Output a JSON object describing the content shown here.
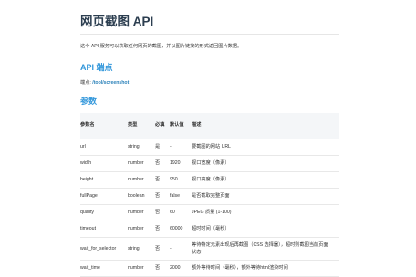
{
  "title": "网页截图 API",
  "intro": "这个 API 服务可以获取任何网页的截图，并以图片链接的形式返回图片数据。",
  "endpoint_section": {
    "heading": "API 端点",
    "label": "端点: ",
    "path": "/tool/screenshot"
  },
  "params_section": {
    "heading": "参数",
    "columns": [
      "参数名",
      "类型",
      "必填",
      "默认值",
      "描述"
    ],
    "rows": [
      {
        "name": "url",
        "type": "string",
        "required": "是",
        "default": "-",
        "desc": "要截图的网站 URL"
      },
      {
        "name": "width",
        "type": "number",
        "required": "否",
        "default": "1920",
        "desc": "视口宽度（像素）"
      },
      {
        "name": "height",
        "type": "number",
        "required": "否",
        "default": "950",
        "desc": "视口高度（像素）"
      },
      {
        "name": "fullPage",
        "type": "boolean",
        "required": "否",
        "default": "false",
        "desc": "是否截取完整页面"
      },
      {
        "name": "quality",
        "type": "number",
        "required": "否",
        "default": "60",
        "desc": "JPEG 质量 (1-100)"
      },
      {
        "name": "timeout",
        "type": "number",
        "required": "否",
        "default": "60000",
        "desc": "超时时间（毫秒）"
      },
      {
        "name": "wait_for_selector",
        "type": "string",
        "required": "否",
        "default": "-",
        "desc": "等待特定元素出现后再截图（CSS 选择器），超时则截图当前页面状态"
      },
      {
        "name": "wait_time",
        "type": "number",
        "required": "否",
        "default": "2000",
        "desc": "额外等待时间（毫秒），额外等待html渲染时间"
      }
    ]
  }
}
